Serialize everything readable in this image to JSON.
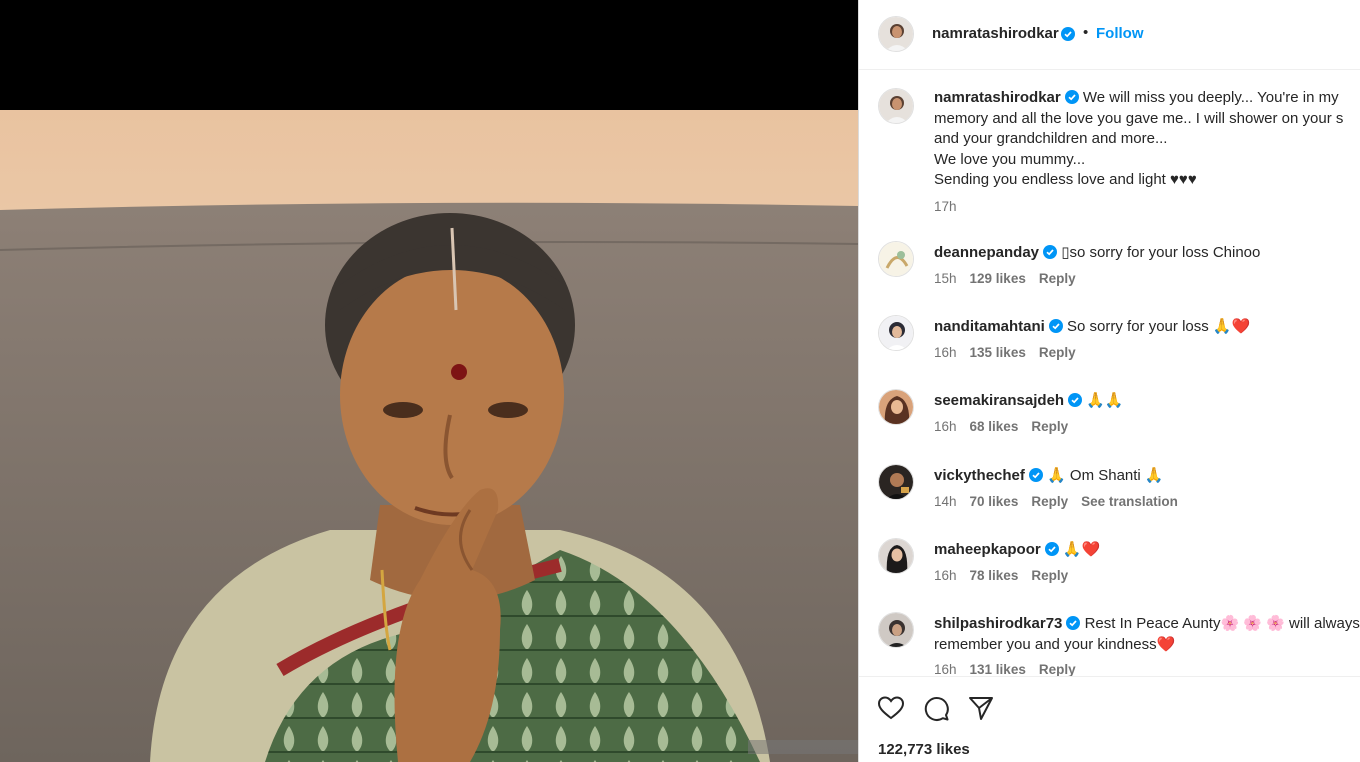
{
  "post": {
    "author": "namratashirodkar",
    "follow_label": "Follow",
    "separator": "•",
    "likes_text": "122,773 likes"
  },
  "caption": {
    "username": "namratashirodkar",
    "line1": "We will miss you deeply... You're in my",
    "line2": "memory and all the love you gave me.. I will shower on your s",
    "line3": "and your grandchildren and more...",
    "line4": "We love you mummy...",
    "line5": "Sending you endless love and light ♥♥♥",
    "time": "17h"
  },
  "comments": [
    {
      "username": "deannepanday",
      "text": "▯so sorry for your loss Chinoo",
      "time": "15h",
      "likes": "129 likes",
      "reply": "Reply"
    },
    {
      "username": "nanditamahtani",
      "text": "So sorry for your loss 🙏❤️",
      "time": "16h",
      "likes": "135 likes",
      "reply": "Reply"
    },
    {
      "username": "seemakiransajdeh",
      "text": "🙏🙏",
      "time": "16h",
      "likes": "68 likes",
      "reply": "Reply"
    },
    {
      "username": "vickythechef",
      "text": "🙏 Om Shanti 🙏",
      "time": "14h",
      "likes": "70 likes",
      "reply": "Reply",
      "translate": "See translation"
    },
    {
      "username": "maheepkapoor",
      "text": "🙏❤️",
      "time": "16h",
      "likes": "78 likes",
      "reply": "Reply"
    },
    {
      "username": "shilpashirodkar73",
      "line1": "Rest In Peace Aunty🌸 🌸 🌸 will always",
      "line2": "remember you and your kindness❤️",
      "time": "16h",
      "likes": "131 likes",
      "reply": "Reply"
    }
  ],
  "icons": {
    "like": "heart-icon",
    "comment": "comment-bubble-icon",
    "share": "paper-plane-icon",
    "verified": "verified-badge-icon"
  },
  "colors": {
    "link_blue": "#0095f6",
    "verified_blue": "#0095f6",
    "text": "#262626",
    "muted": "#737373",
    "heart_red": "#e0245e"
  }
}
